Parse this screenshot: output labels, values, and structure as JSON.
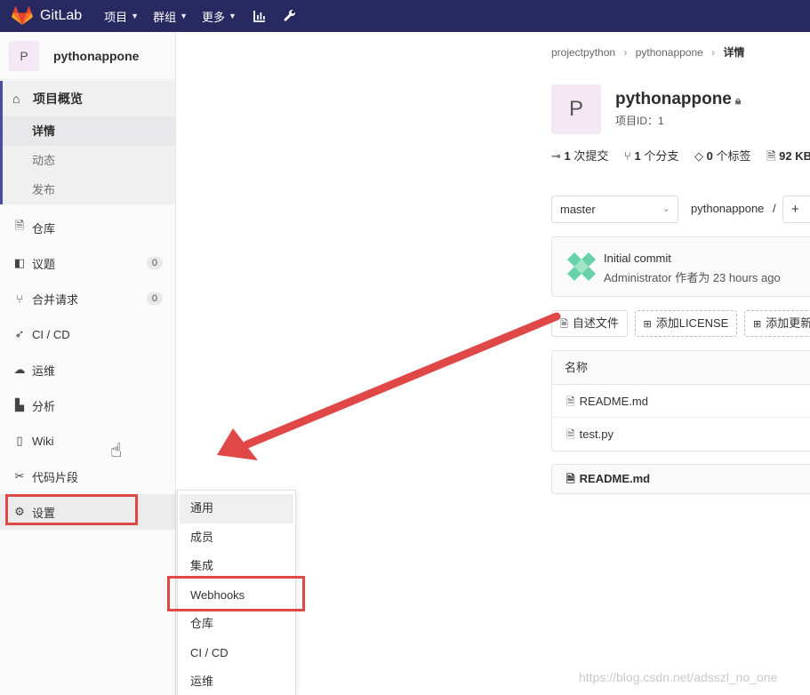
{
  "navbar": {
    "brand": "GitLab",
    "items": [
      {
        "label": "项目",
        "caret": "⌄"
      },
      {
        "label": "群组",
        "caret": "⌄"
      },
      {
        "label": "更多",
        "caret": "⌄"
      }
    ],
    "icons": [
      "chart-icon",
      "wrench-icon"
    ],
    "bg_color": "#292961",
    "logo_color": "#e24329"
  },
  "sidebar": {
    "avatar_letter": "P",
    "project_name": "pythonappone",
    "overview": {
      "label": "项目概览",
      "sub_items": [
        "详情",
        "动态",
        "发布"
      ]
    },
    "items": [
      {
        "label": "仓库",
        "icon": "doc-icon"
      },
      {
        "label": "议题",
        "icon": "issues-icon",
        "badge": "0"
      },
      {
        "label": "合并请求",
        "icon": "merge-icon",
        "badge": "0"
      },
      {
        "label": "CI / CD",
        "icon": "rocket-icon"
      },
      {
        "label": "运维",
        "icon": "cloud-icon"
      },
      {
        "label": "分析",
        "icon": "chart-icon"
      },
      {
        "label": "Wiki",
        "icon": "book-icon"
      },
      {
        "label": "代码片段",
        "icon": "scissors-icon"
      },
      {
        "label": "设置",
        "icon": "gear-icon"
      }
    ],
    "accent": "#4b4ba3"
  },
  "flyout": {
    "items": [
      "通用",
      "成员",
      "集成",
      "Webhooks",
      "仓库",
      "CI / CD",
      "运维"
    ]
  },
  "breadcrumb": {
    "items": [
      "projectpython",
      "pythonappone",
      "详情"
    ],
    "separator": "›"
  },
  "project": {
    "avatar_letter": "P",
    "title": "pythonappone",
    "id_label": "项目ID：",
    "id": "1"
  },
  "stats": [
    {
      "icon": "commit-icon",
      "value": "1",
      "label": "次提交"
    },
    {
      "icon": "branch-icon",
      "value": "1",
      "label": "个分支"
    },
    {
      "icon": "tag-icon",
      "value": "0",
      "label": "个标签"
    },
    {
      "icon": "file-icon",
      "value": "92 KB",
      "label": ""
    }
  ],
  "repo": {
    "branch": "master",
    "path": "pythonappone",
    "path_sep": "/",
    "plus": "+"
  },
  "commit": {
    "title": "Initial commit",
    "author": "Administrator",
    "meta": "作者为 23 hours ago"
  },
  "quick_buttons": [
    "自述文件",
    "添加LICENSE",
    "添加更新"
  ],
  "files": {
    "header": "名称",
    "rows": [
      "README.md",
      "test.py"
    ]
  },
  "readme": {
    "label": "README.md"
  },
  "annotation_color": "#e04848",
  "watermark": "https://blog.csdn.net/adsszl_no_one"
}
